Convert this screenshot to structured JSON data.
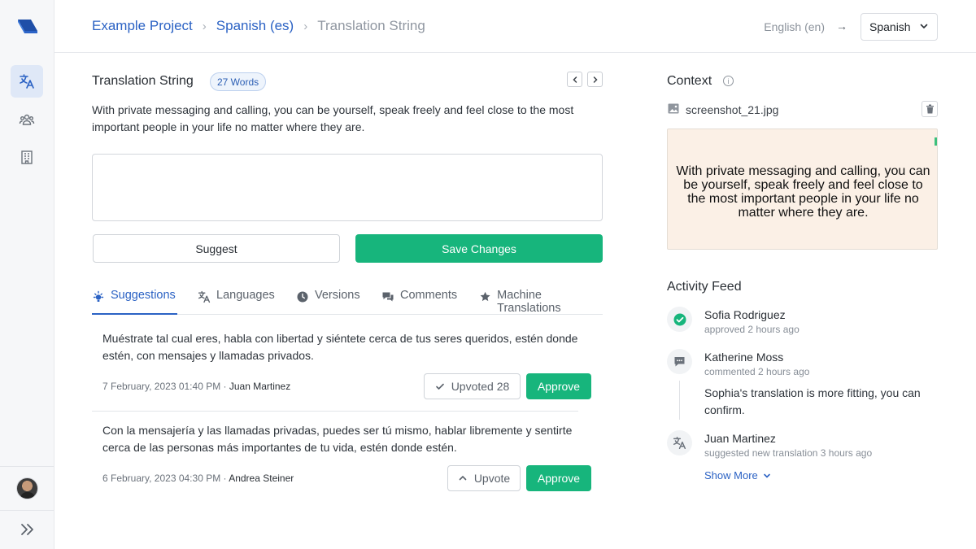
{
  "header": {
    "breadcrumbs": [
      "Example Project",
      "Spanish (es)",
      "Translation String"
    ],
    "source_language": "English (en)",
    "target_language": "Spanish"
  },
  "string": {
    "title": "Translation String",
    "word_badge": "27 Words",
    "source_text": "With private messaging and calling, you can be yourself, speak freely and feel close to the most important people in your life no matter where they are.",
    "translation_value": "",
    "suggest_label": "Suggest",
    "save_label": "Save Changes"
  },
  "tabs": [
    {
      "label": "Suggestions",
      "icon": "lightbulb-icon",
      "active": true
    },
    {
      "label": "Languages",
      "icon": "translate-icon",
      "active": false
    },
    {
      "label": "Versions",
      "icon": "clock-icon",
      "active": false
    },
    {
      "label": "Comments",
      "icon": "comments-icon",
      "active": false
    },
    {
      "label": "Machine Translations",
      "icon": "star-icon",
      "active": false
    }
  ],
  "suggestions": [
    {
      "text": "Muéstrate tal cual eres, habla con libertad y siéntete cerca de tus seres queridos, estén donde estén, con mensajes y llamadas privados.",
      "date": "7 February, 2023 01:40 PM · ",
      "author": "Juan Martinez",
      "vote_label": "Upvoted 28",
      "approve_label": "Approve"
    },
    {
      "text": "Con la mensajería y las llamadas privadas, puedes ser tú mismo, hablar libremente y sentirte cerca de las personas más importantes de tu vida, estén donde estén.",
      "date": "6 February, 2023 04:30 PM · ",
      "author": "Andrea Steiner",
      "vote_label": "Upvote",
      "approve_label": "Approve"
    }
  ],
  "context": {
    "title": "Context",
    "file_name": "screenshot_21.jpg",
    "screenshot_text": "With private messaging and calling, you can be yourself, speak freely and feel close to the most important people in your life no matter where they are."
  },
  "activity": {
    "title": "Activity Feed",
    "items": [
      {
        "name": "Sofia Rodriguez",
        "sub": "approved 2 hours ago",
        "icon": "check-circle-icon"
      },
      {
        "name": "Katherine Moss",
        "sub": "commented 2 hours ago",
        "icon": "comment-icon",
        "comment": "Sophia's translation is more fitting, you can confirm."
      },
      {
        "name": "Juan Martinez",
        "sub": "suggested new translation 3 hours ago",
        "icon": "translate-icon"
      }
    ],
    "show_more": "Show More"
  },
  "colors": {
    "accent": "#2b62c4",
    "success": "#17b57c"
  }
}
